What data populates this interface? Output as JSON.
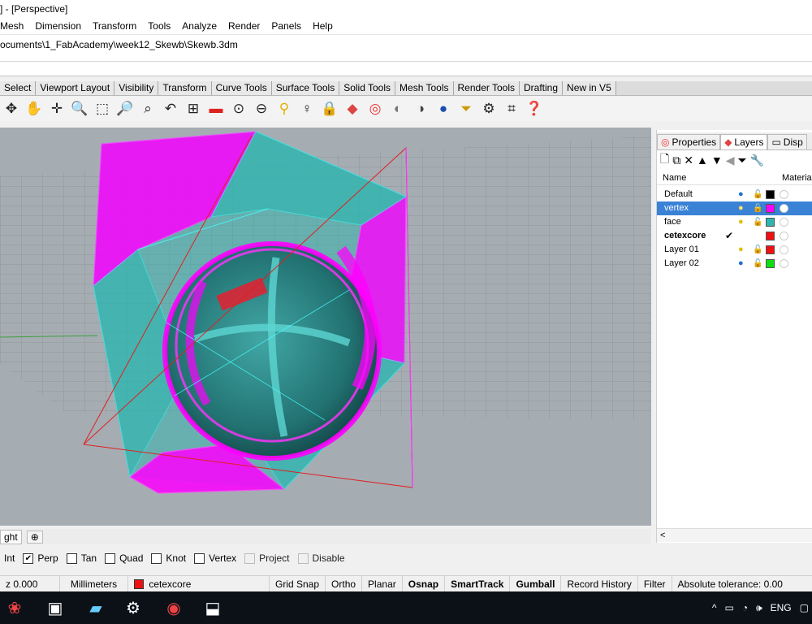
{
  "window": {
    "title": "] - [Perspective]"
  },
  "menu": [
    "Mesh",
    "Dimension",
    "Transform",
    "Tools",
    "Analyze",
    "Render",
    "Panels",
    "Help"
  ],
  "command": {
    "path": "ocuments\\1_FabAcademy\\week12_Skewb\\Skewb.3dm"
  },
  "toolbar_tabs": [
    "Select",
    "Viewport Layout",
    "Visibility",
    "Transform",
    "Curve Tools",
    "Surface Tools",
    "Solid Tools",
    "Mesh Tools",
    "Render Tools",
    "Drafting",
    "New in V5"
  ],
  "toolbar_icons": [
    "move-icon",
    "pan-icon",
    "rotate-view-icon",
    "zoom-icon",
    "zoom-window-icon",
    "zoom-extents-icon",
    "zoom-selected-icon",
    "undo-view-icon",
    "four-viewports-icon",
    "car-icon",
    "named-view-icon",
    "cplane-icon",
    "light-icon",
    "bulb-icon",
    "lock-icon",
    "layer-icon",
    "color-wheel-icon",
    "shade-icon",
    "rendered-icon",
    "sphere-icon",
    "filter-icon",
    "gear-icon",
    "select-points-icon",
    "help-icon"
  ],
  "viewport": {
    "name": "Perspective",
    "background": "#a5adb3"
  },
  "viewport_tabs": {
    "active": "ght",
    "add_label": "⊕"
  },
  "panel": {
    "tabs": [
      {
        "label": "Properties",
        "icon": "properties-icon"
      },
      {
        "label": "Layers",
        "icon": "layers-icon"
      },
      {
        "label": "Disp",
        "icon": "display-icon"
      }
    ],
    "tools": [
      "new-layer-icon",
      "new-sublayer-icon",
      "delete-icon",
      "move-up-icon",
      "move-down-icon",
      "move-left-icon",
      "filter-icon",
      "tools-icon"
    ],
    "headers": {
      "name": "Name",
      "material": "Material"
    },
    "layers": [
      {
        "name": "Default",
        "bulb": "💡",
        "lock": "🔓",
        "color": "#000000",
        "selected": false,
        "current": false
      },
      {
        "name": "vertex",
        "bulb": "💡",
        "lock": "🔓",
        "color": "#ff00ff",
        "selected": true,
        "current": false
      },
      {
        "name": "face",
        "bulb": "💡",
        "lock": "🔓",
        "color": "#2fb5b0",
        "selected": false,
        "current": false
      },
      {
        "name": "cetexcore",
        "bulb": "",
        "lock": "",
        "color": "#ee1111",
        "selected": false,
        "current": true,
        "check": "✔"
      },
      {
        "name": "Layer 01",
        "bulb": "💡",
        "lock": "🔓",
        "color": "#ee1111",
        "selected": false,
        "current": false
      },
      {
        "name": "Layer 02",
        "bulb": "💡",
        "lock": "🔓",
        "color": "#11dd11",
        "selected": false,
        "current": false
      }
    ],
    "scroll_left": "<"
  },
  "osnap": [
    {
      "label": "Int",
      "checked": null
    },
    {
      "label": "Perp",
      "checked": true
    },
    {
      "label": "Tan",
      "checked": false
    },
    {
      "label": "Quad",
      "checked": false
    },
    {
      "label": "Knot",
      "checked": false
    },
    {
      "label": "Vertex",
      "checked": false
    },
    {
      "label": "Project",
      "checked": false,
      "disabled": true
    },
    {
      "label": "Disable",
      "checked": false,
      "disabled": true
    }
  ],
  "status": {
    "coord": "z 0.000",
    "units": "Millimeters",
    "layer": "cetexcore",
    "layer_color": "#ee1111",
    "toggles": [
      {
        "label": "Grid Snap",
        "bold": false
      },
      {
        "label": "Ortho",
        "bold": false
      },
      {
        "label": "Planar",
        "bold": false
      },
      {
        "label": "Osnap",
        "bold": true
      },
      {
        "label": "SmartTrack",
        "bold": true
      },
      {
        "label": "Gumball",
        "bold": true
      },
      {
        "label": "Record History",
        "bold": false
      },
      {
        "label": "Filter",
        "bold": false
      }
    ],
    "tolerance": "Absolute tolerance: 0.00"
  },
  "taskbar": {
    "apps": [
      "app-icon",
      "rhino-icon",
      "notes-icon",
      "settings-icon",
      "chrome-icon",
      "cutter-icon"
    ],
    "tray_lang": "ENG"
  },
  "colors": {
    "magenta": "#ff00ff",
    "cyan": "#2fb5b0",
    "selection": "#3a82d6"
  }
}
